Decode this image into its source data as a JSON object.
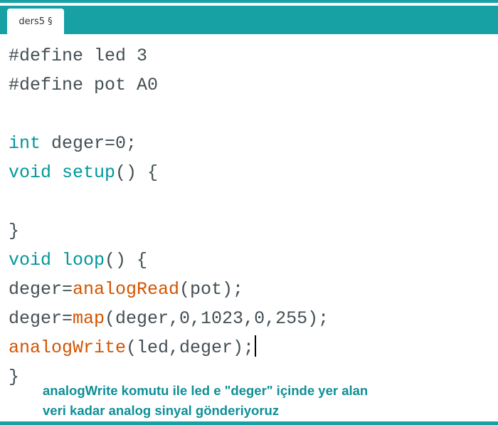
{
  "tab": {
    "label": "ders5 §"
  },
  "code": {
    "l1": {
      "a": "#define led 3"
    },
    "l2": {
      "a": "#define pot A0"
    },
    "l4": {
      "kw": "int",
      "rest": " deger=0;"
    },
    "l5": {
      "kw": "void",
      "fn": " setup",
      "rest": "() {"
    },
    "l7": {
      "a": "}"
    },
    "l8": {
      "kw": "void",
      "fn": " loop",
      "rest": "() {"
    },
    "l9": {
      "a": "deger=",
      "fn": "analogRead",
      "rest": "(pot);"
    },
    "l10": {
      "a": "deger=",
      "fn": "map",
      "rest": "(deger,0,1023,0,255);"
    },
    "l11": {
      "fn": "analogWrite",
      "rest": "(led,deger);"
    },
    "l12": {
      "a": "}"
    }
  },
  "caption": {
    "line1": "analogWrite komutu ile led e \"deger\" içinde yer alan",
    "line2": "veri kadar analog sinyal gönderiyoruz"
  },
  "colors": {
    "accent": "#17a1a5",
    "keyword": "#00979c",
    "function": "#d35400",
    "text": "#434f54",
    "caption": "#0f8f97"
  }
}
